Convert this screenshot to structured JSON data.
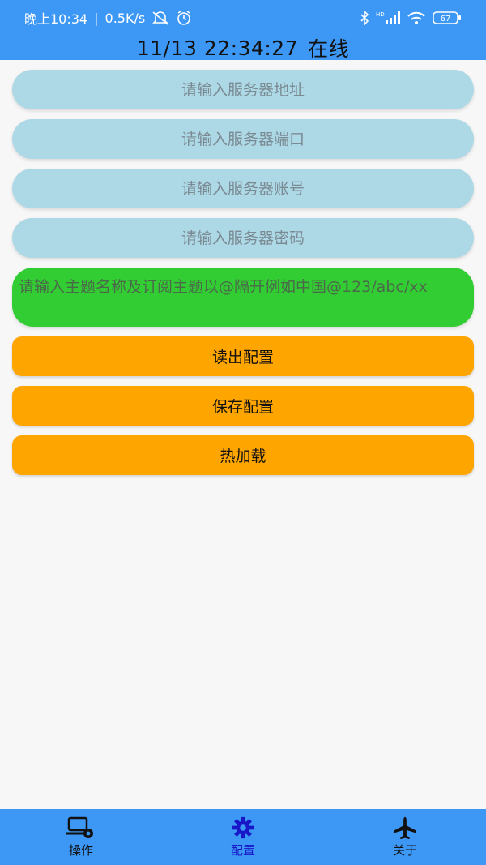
{
  "status_bar": {
    "time": "晚上10:34",
    "separator": "|",
    "speed": "0.5K/s",
    "battery": "67",
    "icons": [
      "mute-icon",
      "alarm-icon",
      "bluetooth-icon",
      "hd-signal-icon",
      "wifi-icon",
      "battery-icon"
    ]
  },
  "header": {
    "datetime": "11/13 22:34:27",
    "status": "在线"
  },
  "form": {
    "server_address_placeholder": "请输入服务器地址",
    "server_port_placeholder": "请输入服务器端口",
    "server_account_placeholder": "请输入服务器账号",
    "server_password_placeholder": "请输入服务器密码",
    "topic_placeholder": "请输入主题名称及订阅主题以@隔开例如中国@123/abc/xx"
  },
  "buttons": {
    "read_config": "读出配置",
    "save_config": "保存配置",
    "hot_reload": "热加载"
  },
  "bottom_nav": {
    "items": [
      {
        "label": "操作",
        "icon": "laptop-gear-icon"
      },
      {
        "label": "配置",
        "icon": "gear-icon",
        "active": true
      },
      {
        "label": "关于",
        "icon": "airplane-icon"
      }
    ]
  },
  "colors": {
    "primary": "#3d97f5",
    "input_bg": "#add8e6",
    "topic_bg": "#32cd32",
    "button_bg": "#ffa500",
    "active_nav": "#1818c8"
  }
}
